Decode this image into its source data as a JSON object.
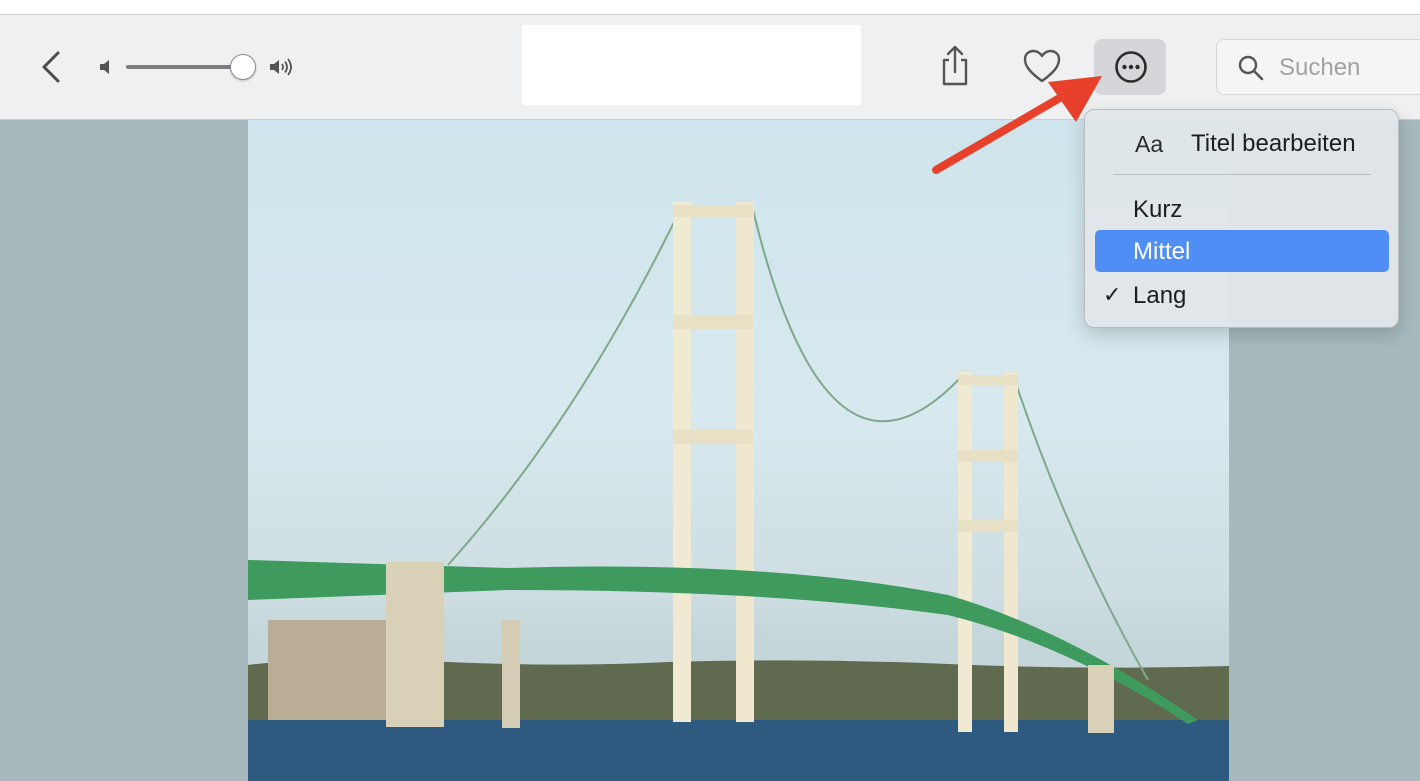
{
  "toolbar": {
    "back_icon": "chevron-left-icon",
    "volume_low_icon": "speaker-low-icon",
    "volume_high_icon": "speaker-high-icon",
    "volume_level": 0.9,
    "share_icon": "share-icon",
    "favorite_icon": "heart-icon",
    "more_icon": "ellipsis-circle-icon",
    "search": {
      "placeholder": "Suchen",
      "value": ""
    }
  },
  "photo": {
    "subject_icon": "bridge-photo"
  },
  "menu": {
    "edit_title": {
      "prefix": "Aa",
      "label": "Titel bearbeiten"
    },
    "options": [
      {
        "label": "Kurz",
        "selected": false,
        "highlighted": false
      },
      {
        "label": "Mittel",
        "selected": false,
        "highlighted": true
      },
      {
        "label": "Lang",
        "selected": true,
        "highlighted": false
      }
    ],
    "check_glyph": "✓"
  },
  "colors": {
    "accent": "#4f8ef5",
    "annotation_arrow": "#e8402a"
  }
}
